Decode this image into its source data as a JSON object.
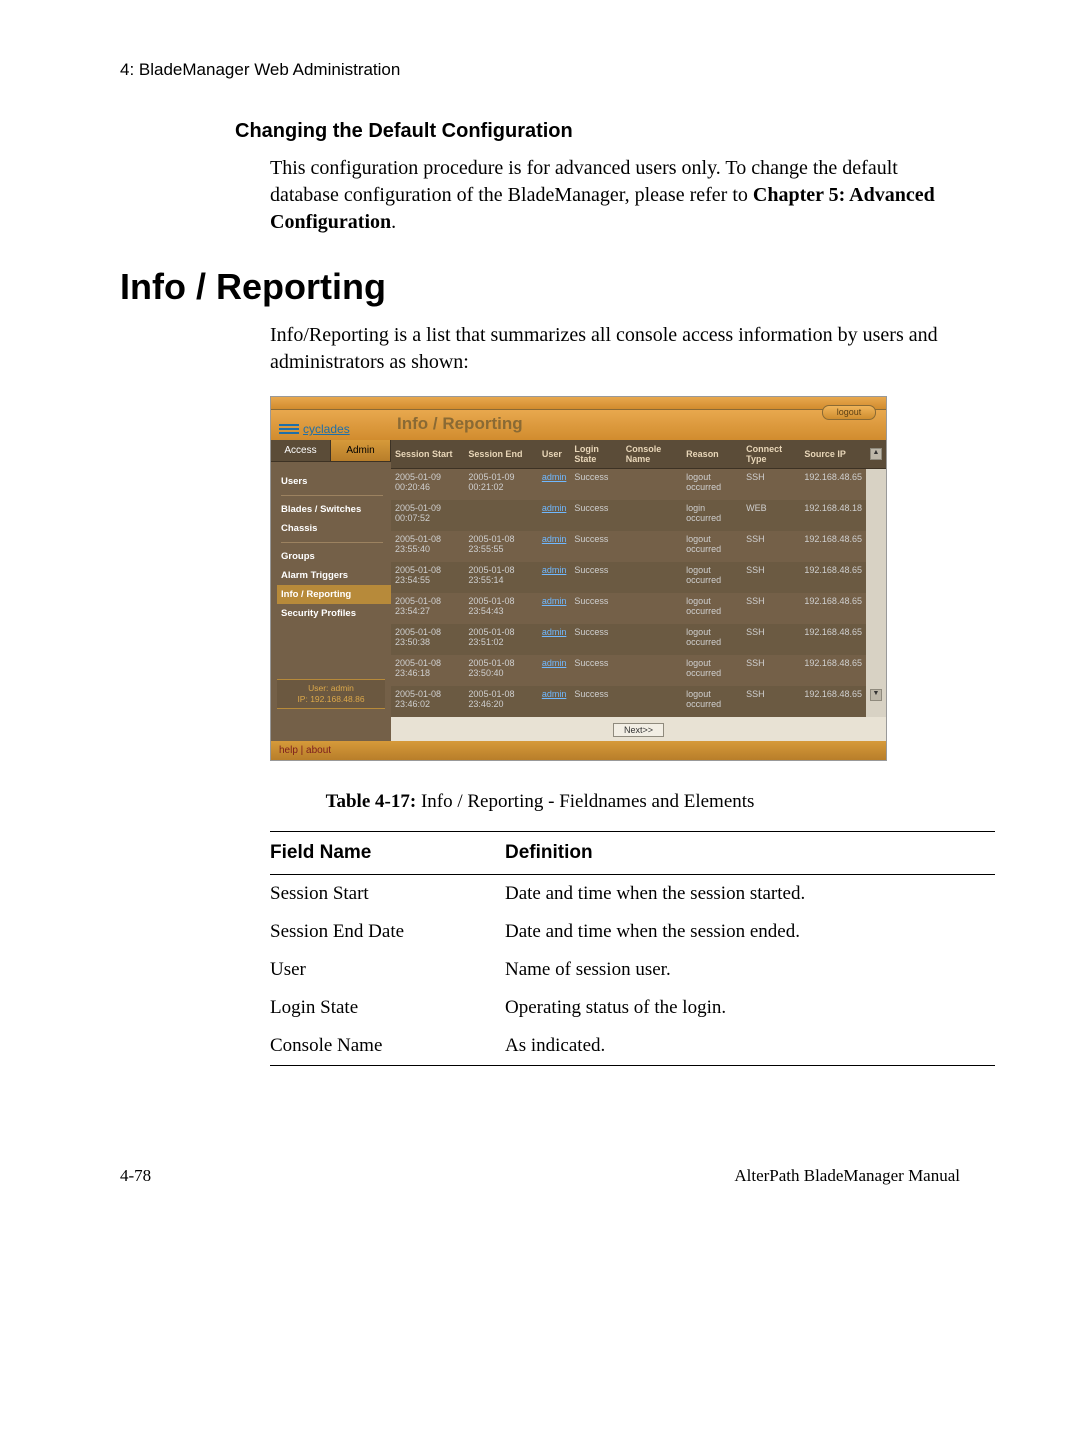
{
  "running_head": "4: BladeManager Web Administration",
  "section_title": "Changing the Default Configuration",
  "section_body_pre": "This configuration procedure is for advanced users only. To change the default database configuration of the BladeManager, please refer to ",
  "section_body_bold": "Chapter 5: Advanced Configuration",
  "section_body_post": ".",
  "h1": "Info / Reporting",
  "intro": "Info/Reporting is a list that summarizes all console access information by users and administrators as shown:",
  "app": {
    "logout": "logout",
    "brand": "cyclades",
    "page_title": "Info / Reporting",
    "tabs": {
      "access": "Access",
      "admin": "Admin"
    },
    "nav": [
      "Users",
      "Blades / Switches",
      "Chassis",
      "Groups",
      "Alarm Triggers",
      "Info / Reporting",
      "Security Profiles"
    ],
    "nav_selected_index": 5,
    "userbox_line1": "User: admin",
    "userbox_line2": "IP: 192.168.48.86",
    "help_links": "help  |  about",
    "columns": [
      "Session Start",
      "Session End",
      "User",
      "Login State",
      "Console Name",
      "Reason",
      "Connect Type",
      "Source IP"
    ],
    "rows": [
      {
        "start": "2005-01-09 00:20:46",
        "end": "2005-01-09 00:21:02",
        "user": "admin",
        "state": "Success",
        "console": "",
        "reason": "logout occurred",
        "ctype": "SSH",
        "ip": "192.168.48.65"
      },
      {
        "start": "2005-01-09 00:07:52",
        "end": "",
        "user": "admin",
        "state": "Success",
        "console": "",
        "reason": "login occurred",
        "ctype": "WEB",
        "ip": "192.168.48.18"
      },
      {
        "start": "2005-01-08 23:55:40",
        "end": "2005-01-08 23:55:55",
        "user": "admin",
        "state": "Success",
        "console": "",
        "reason": "logout occurred",
        "ctype": "SSH",
        "ip": "192.168.48.65"
      },
      {
        "start": "2005-01-08 23:54:55",
        "end": "2005-01-08 23:55:14",
        "user": "admin",
        "state": "Success",
        "console": "",
        "reason": "logout occurred",
        "ctype": "SSH",
        "ip": "192.168.48.65"
      },
      {
        "start": "2005-01-08 23:54:27",
        "end": "2005-01-08 23:54:43",
        "user": "admin",
        "state": "Success",
        "console": "",
        "reason": "logout occurred",
        "ctype": "SSH",
        "ip": "192.168.48.65"
      },
      {
        "start": "2005-01-08 23:50:38",
        "end": "2005-01-08 23:51:02",
        "user": "admin",
        "state": "Success",
        "console": "",
        "reason": "logout occurred",
        "ctype": "SSH",
        "ip": "192.168.48.65"
      },
      {
        "start": "2005-01-08 23:46:18",
        "end": "2005-01-08 23:50:40",
        "user": "admin",
        "state": "Success",
        "console": "",
        "reason": "logout occurred",
        "ctype": "SSH",
        "ip": "192.168.48.65"
      },
      {
        "start": "2005-01-08 23:46:02",
        "end": "2005-01-08 23:46:20",
        "user": "admin",
        "state": "Success",
        "console": "",
        "reason": "logout occurred",
        "ctype": "SSH",
        "ip": "192.168.48.65"
      }
    ],
    "next_label": "Next>>"
  },
  "caption_bold": "Table 4-17:",
  "caption_rest": " Info / Reporting - Fieldnames and Elements",
  "def_table": {
    "headers": [
      "Field Name",
      "Definition"
    ],
    "rows": [
      [
        "Session Start",
        "Date and time when the session started."
      ],
      [
        "Session End Date",
        "Date and time when the session ended."
      ],
      [
        "User",
        "Name of session user."
      ],
      [
        "Login State",
        "Operating status of the login."
      ],
      [
        "Console Name",
        "As indicated."
      ]
    ]
  },
  "footer_left": "4-78",
  "footer_right": "AlterPath BladeManager Manual"
}
